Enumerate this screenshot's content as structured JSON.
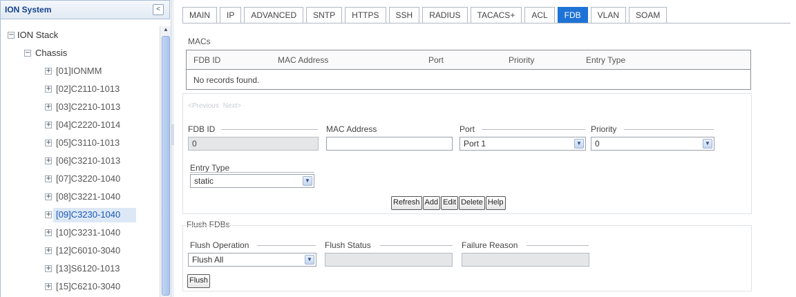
{
  "tree": {
    "title": "ION System",
    "collapse_glyph": "<",
    "root_label": "ION Stack",
    "chassis_label": "Chassis",
    "items": [
      {
        "label": "[01]IONMM"
      },
      {
        "label": "[02]C2110-1013"
      },
      {
        "label": "[03]C2210-1013"
      },
      {
        "label": "[04]C2220-1014"
      },
      {
        "label": "[05]C3110-1013"
      },
      {
        "label": "[06]C3210-1013"
      },
      {
        "label": "[07]C3220-1040"
      },
      {
        "label": "[08]C3221-1040"
      },
      {
        "label": "[09]C3230-1040",
        "selected": true
      },
      {
        "label": "[10]C3231-1040"
      },
      {
        "label": "[12]C6010-3040"
      },
      {
        "label": "[13]S6120-1013"
      },
      {
        "label": "[15]C6210-3040"
      }
    ]
  },
  "tabs": [
    {
      "label": "MAIN"
    },
    {
      "label": "IP"
    },
    {
      "label": "ADVANCED"
    },
    {
      "label": "SNTP"
    },
    {
      "label": "HTTPS"
    },
    {
      "label": "SSH"
    },
    {
      "label": "RADIUS"
    },
    {
      "label": "TACACS+"
    },
    {
      "label": "ACL"
    },
    {
      "label": "FDB",
      "active": true
    },
    {
      "label": "VLAN"
    },
    {
      "label": "SOAM"
    }
  ],
  "macs": {
    "section_label": "MACs",
    "columns": [
      "FDB ID",
      "MAC Address",
      "Port",
      "Priority",
      "Entry Type"
    ],
    "empty_text": "No records found.",
    "pager_prev": "<Previous",
    "pager_next": "Next>"
  },
  "form": {
    "fdb_id_label": "FDB ID",
    "fdb_id_value": "0",
    "mac_label": "MAC Address",
    "mac_value": "",
    "port_label": "Port",
    "port_value": "Port 1",
    "priority_label": "Priority",
    "priority_value": "0",
    "entry_type_label": "Entry Type",
    "entry_type_value": "static"
  },
  "buttons": {
    "refresh": "Refresh",
    "add": "Add",
    "edit": "Edit",
    "delete": "Delete",
    "help": "Help"
  },
  "flush": {
    "section_label": "Flush FDBs",
    "operation_label": "Flush Operation",
    "operation_value": "Flush All",
    "status_label": "Flush Status",
    "status_value": "",
    "reason_label": "Failure Reason",
    "reason_value": "",
    "button": "Flush"
  },
  "colors": {
    "active_tab": "#1f73d6",
    "selected_node": "#1a58b5"
  }
}
